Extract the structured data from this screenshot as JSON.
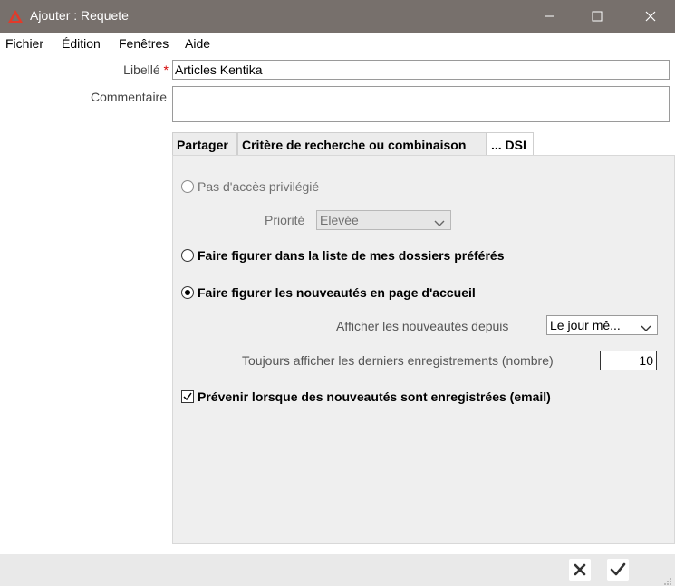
{
  "window": {
    "title": "Ajouter : Requete",
    "icon": "kentika-logo-icon"
  },
  "menu": [
    "Fichier",
    "Édition",
    "Fenêtres",
    "Aide"
  ],
  "form": {
    "libelle_label": "Libellé",
    "required_mark": "*",
    "libelle_value": "Articles Kentika",
    "commentaire_label": "Commentaire",
    "commentaire_value": ""
  },
  "tabs": [
    {
      "label": "Partager",
      "active": false
    },
    {
      "label": "Critère de recherche ou combinaison",
      "active": false
    },
    {
      "label": "... DSI",
      "active": true
    }
  ],
  "dsi": {
    "option_pas_acces": {
      "label": "Pas d'accès privilégié",
      "selected": false,
      "enabled": false
    },
    "priorite_label": "Priorité",
    "priorite_value": "Elevée",
    "option_dossiers": {
      "label": "Faire figurer dans la liste de mes dossiers préférés",
      "selected": false
    },
    "option_accueil": {
      "label": "Faire figurer les nouveautés en page d'accueil",
      "selected": true
    },
    "afficher_depuis_label": "Afficher les nouveautés depuis",
    "afficher_depuis_value": "Le jour mê...",
    "toujours_label": "Toujours afficher les derniers enregistrements (nombre)",
    "toujours_value": "10",
    "prevenir": {
      "label": "Prévenir lorsque des nouveautés sont enregistrées (email)",
      "checked": true
    }
  },
  "footer": {
    "cancel_icon": "close-icon",
    "ok_icon": "check-icon"
  },
  "colors": {
    "titlebar": "#77706c",
    "required": "#d40000",
    "panel": "#efefef"
  }
}
